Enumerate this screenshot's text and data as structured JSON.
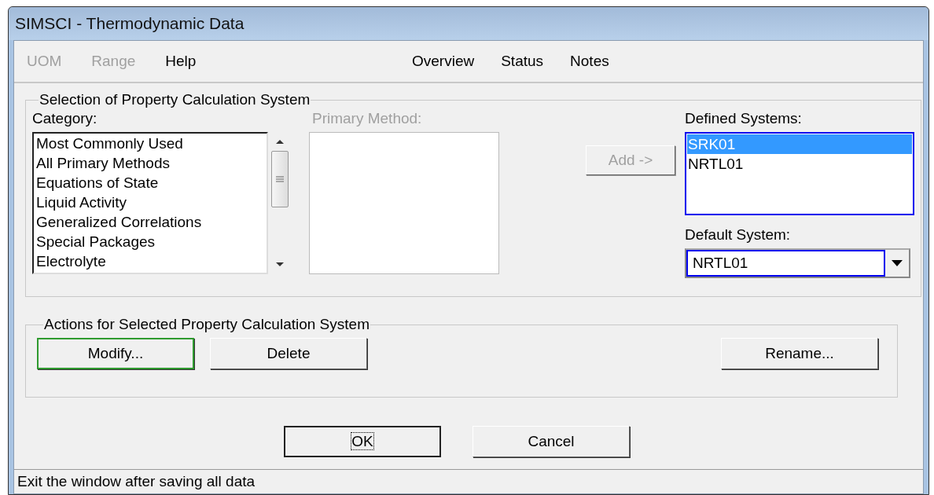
{
  "window": {
    "title": "SIMSCI - Thermodynamic Data"
  },
  "menu_left": [
    {
      "label": "UOM",
      "disabled": true
    },
    {
      "label": "Range",
      "disabled": true
    },
    {
      "label": "Help",
      "disabled": false
    }
  ],
  "menu_right": [
    {
      "label": "Overview",
      "disabled": false
    },
    {
      "label": "Status",
      "disabled": false
    },
    {
      "label": "Notes",
      "disabled": false
    }
  ],
  "selection_group": {
    "title": "Selection of Property Calculation System",
    "category": {
      "label": "Category:",
      "items": [
        {
          "label": "Most Commonly Used",
          "selected": false
        },
        {
          "label": "All Primary Methods",
          "selected": false
        },
        {
          "label": "Equations of State",
          "selected": false
        },
        {
          "label": "Liquid Activity",
          "selected": false
        },
        {
          "label": "Generalized Correlations",
          "selected": false
        },
        {
          "label": "Special Packages",
          "selected": false
        },
        {
          "label": "Electrolyte",
          "selected": false
        }
      ]
    },
    "primary_method": {
      "label": "Primary Method:",
      "disabled": true
    },
    "add_button": {
      "label": "Add ->",
      "disabled": true
    },
    "defined_systems": {
      "label": "Defined Systems:",
      "items": [
        {
          "label": "SRK01",
          "selected": true
        },
        {
          "label": "NRTL01",
          "selected": false
        }
      ]
    },
    "default_system": {
      "label": "Default System:",
      "value": "NRTL01"
    }
  },
  "actions_group": {
    "title": "Actions for Selected Property Calculation System",
    "buttons": [
      {
        "label": "Modify...",
        "hovered": true
      },
      {
        "label": "Delete",
        "hovered": false
      },
      {
        "label": "Rename...",
        "hovered": false
      }
    ]
  },
  "dialog_buttons": [
    {
      "label": "OK",
      "default": true
    },
    {
      "label": "Cancel",
      "default": false
    }
  ],
  "status_bar": {
    "text": "Exit the window after saving all data"
  }
}
